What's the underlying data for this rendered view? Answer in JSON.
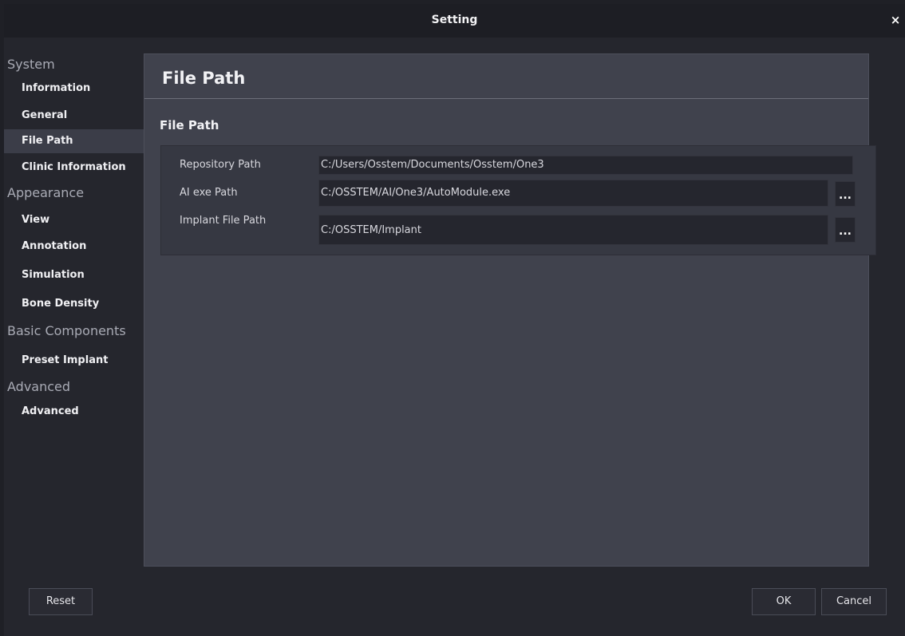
{
  "window": {
    "title": "Setting",
    "close_glyph": "×"
  },
  "sidebar": {
    "sections": [
      {
        "label": "System",
        "items": [
          {
            "label": "Information"
          },
          {
            "label": "General"
          },
          {
            "label": "File Path",
            "active": true
          },
          {
            "label": "Clinic Information"
          }
        ]
      },
      {
        "label": "Appearance",
        "items": [
          {
            "label": "View"
          },
          {
            "label": "Annotation"
          },
          {
            "label": "Simulation"
          },
          {
            "label": "Bone Density"
          }
        ]
      },
      {
        "label": "Basic Components",
        "items": [
          {
            "label": "Preset Implant"
          }
        ]
      },
      {
        "label": "Advanced",
        "items": [
          {
            "label": "Advanced"
          }
        ]
      }
    ]
  },
  "main": {
    "header": "File Path",
    "section_title": "File Path",
    "paths": [
      {
        "label": "Repository Path",
        "value": "C:/Users/Osstem/Documents/Osstem/One3"
      },
      {
        "label": "AI exe Path",
        "value": "C:/OSSTEM/AI/One3/AutoModule.exe",
        "browse_label": "..."
      },
      {
        "label": "Implant File Path",
        "value": "C:/OSSTEM/Implant",
        "browse_label": "..."
      }
    ]
  },
  "footer": {
    "reset_label": "Reset",
    "ok_label": "OK",
    "cancel_label": "Cancel"
  },
  "colors": {
    "background": "#25262d",
    "panel": "#40424d",
    "active_item": "#3b3d48",
    "field": "#25262e"
  }
}
